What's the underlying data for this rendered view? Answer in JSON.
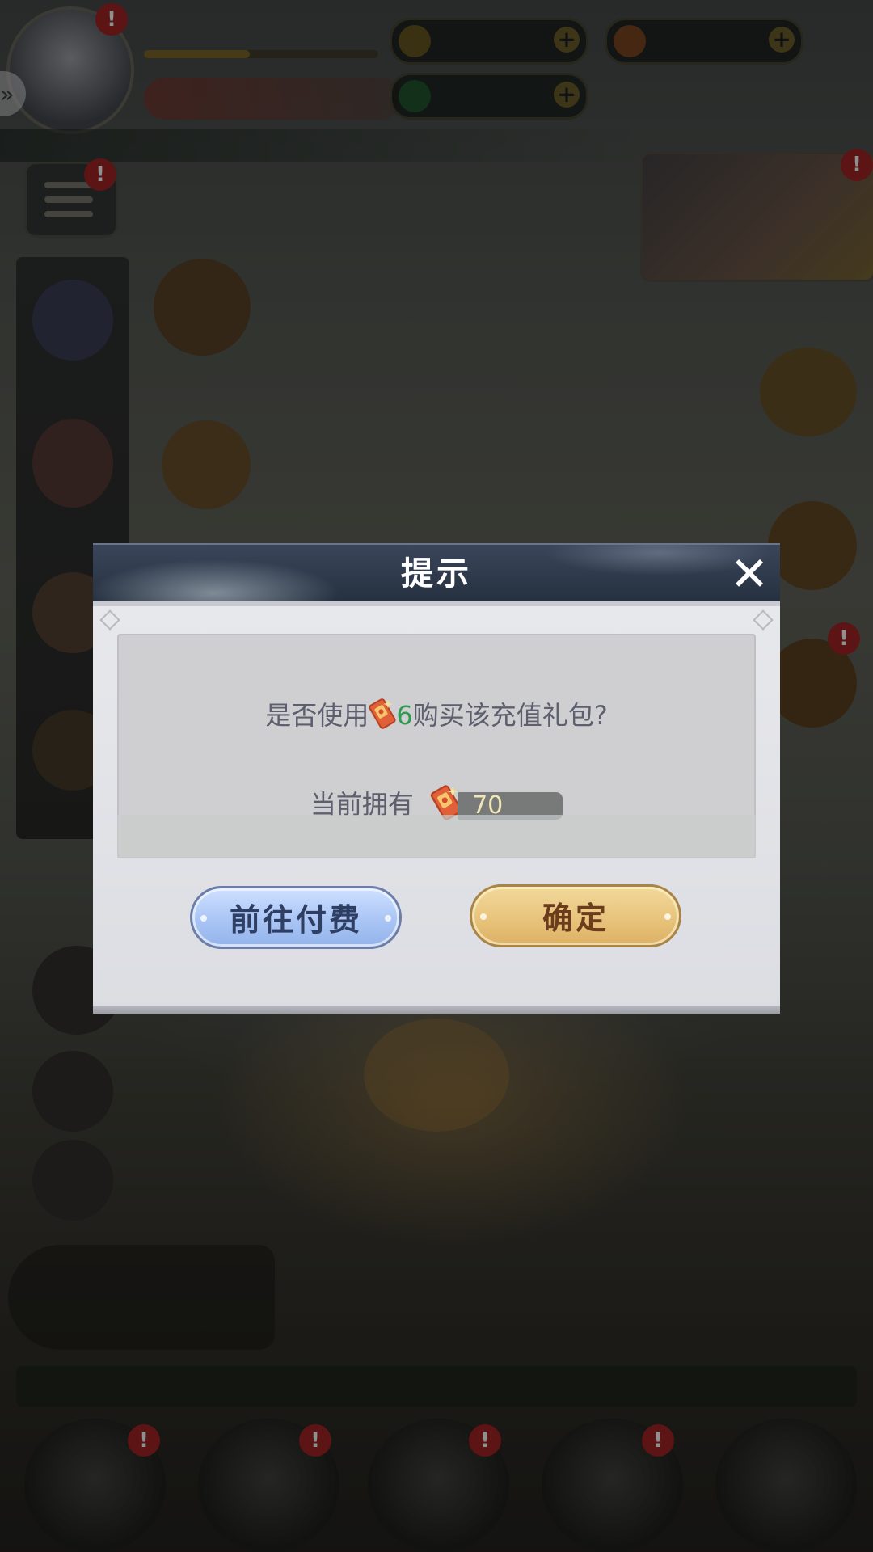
{
  "dialog": {
    "title": "提示",
    "close_label": "✕",
    "message_prefix": "是否使用",
    "message_amount": "6",
    "message_suffix": "购买该充值礼包?",
    "owned_label": "当前拥有",
    "owned_amount": "70",
    "pay_button_label": "前往付费",
    "confirm_button_label": "确定",
    "ticket_icon": "red-ticket-icon"
  },
  "colors": {
    "header_blue": "#25303f",
    "amount_green": "#2f9a52",
    "pay_button_blue": "#a9c5f5",
    "confirm_button_gold": "#e8c47c"
  }
}
